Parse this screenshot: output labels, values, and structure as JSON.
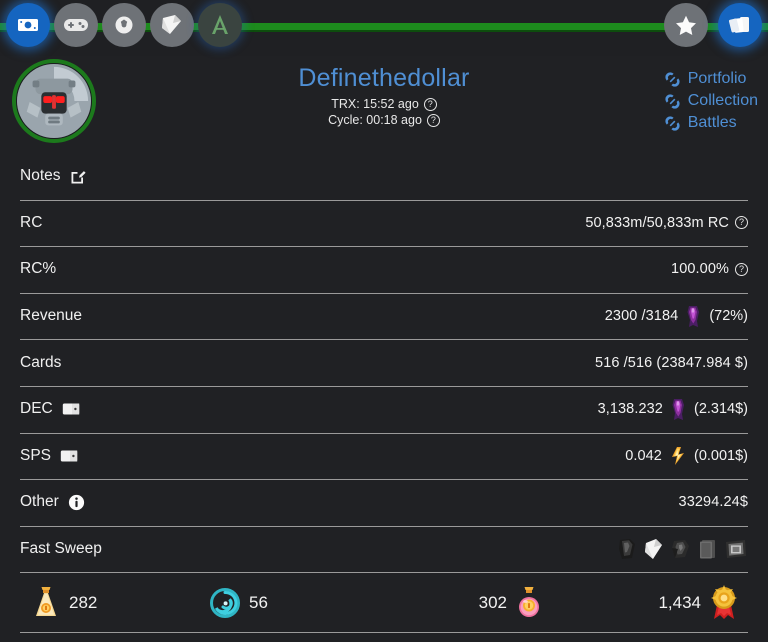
{
  "nav": {
    "left_items": [
      {
        "name": "cash-icon",
        "label": "Cash",
        "state": "active"
      },
      {
        "name": "gamepad-icon",
        "label": "Gamepad",
        "state": "normal"
      },
      {
        "name": "shield-ball-icon",
        "label": "Battles",
        "state": "normal"
      },
      {
        "name": "card-pack-icon",
        "label": "Packs",
        "state": "normal"
      },
      {
        "name": "alpha-logo-icon",
        "label": "Alpha",
        "state": "dim"
      }
    ],
    "right_items": [
      {
        "name": "star-icon",
        "label": "Favorites",
        "state": "normal"
      },
      {
        "name": "cards-icon",
        "label": "Cards",
        "state": "active"
      }
    ]
  },
  "header": {
    "avatar_name": "robot-avatar",
    "title": "Definethedollar",
    "trx_label": "TRX: 15:52 ago",
    "cycle_label": "Cycle: 00:18 ago",
    "help_glyph": "?",
    "links": [
      {
        "label": "Portfolio",
        "name": "link-portfolio"
      },
      {
        "label": "Collection",
        "name": "link-collection"
      },
      {
        "label": "Battles",
        "name": "link-battles"
      }
    ],
    "accent_color": "#4f8fd4",
    "avatar_ring_color": "#1c7a1c",
    "rail_color": "#1d8b1d"
  },
  "rows": {
    "notes": {
      "label": "Notes",
      "icon": "edit-pencil-icon"
    },
    "rc": {
      "label": "RC",
      "value": "50,833m/50,833m RC",
      "help": "?"
    },
    "rc_pct": {
      "label": "RC%",
      "value": "100.00%",
      "help": "?"
    },
    "revenue": {
      "label": "Revenue",
      "value": "2300 /3184",
      "token": "dec-token-icon",
      "suffix": "(72%)"
    },
    "cards": {
      "label": "Cards",
      "value": "516 /516 (23847.984 $)"
    },
    "dec": {
      "label": "DEC",
      "label_icon": "wallet-icon",
      "value": "3,138.232",
      "token": "dec-token-icon",
      "suffix": "(2.314$)"
    },
    "sps": {
      "label": "SPS",
      "label_icon": "wallet-icon",
      "value": "0.042",
      "token": "sps-token-icon",
      "suffix": "(0.001$)"
    },
    "other": {
      "label": "Other",
      "label_icon": "info-icon",
      "value": "33294.24$"
    },
    "fast_sweep": {
      "label": "Fast Sweep",
      "icons": [
        "pack-chaos-icon",
        "pack-white-icon",
        "pack-rift-icon",
        "pack-gray-icon",
        "pack-frame-icon"
      ]
    }
  },
  "bottom_stats": [
    {
      "name": "potion-gold-icon",
      "value": "282",
      "order": "icon-first",
      "color": "#f0c04a"
    },
    {
      "name": "vortex-teal-icon",
      "value": "56",
      "order": "icon-first",
      "color": "#3ec6d4"
    },
    {
      "name": "potion-pink-icon",
      "value": "302",
      "order": "value-first",
      "color": "#f0719e"
    },
    {
      "name": "merit-badge-icon",
      "value": "1,434",
      "order": "value-first",
      "color": "#e8b33c"
    }
  ],
  "theme": {
    "background": "#202124",
    "separator": "#9a9a9a",
    "text": "#f2f2f2",
    "link": "#4f8fd4"
  }
}
